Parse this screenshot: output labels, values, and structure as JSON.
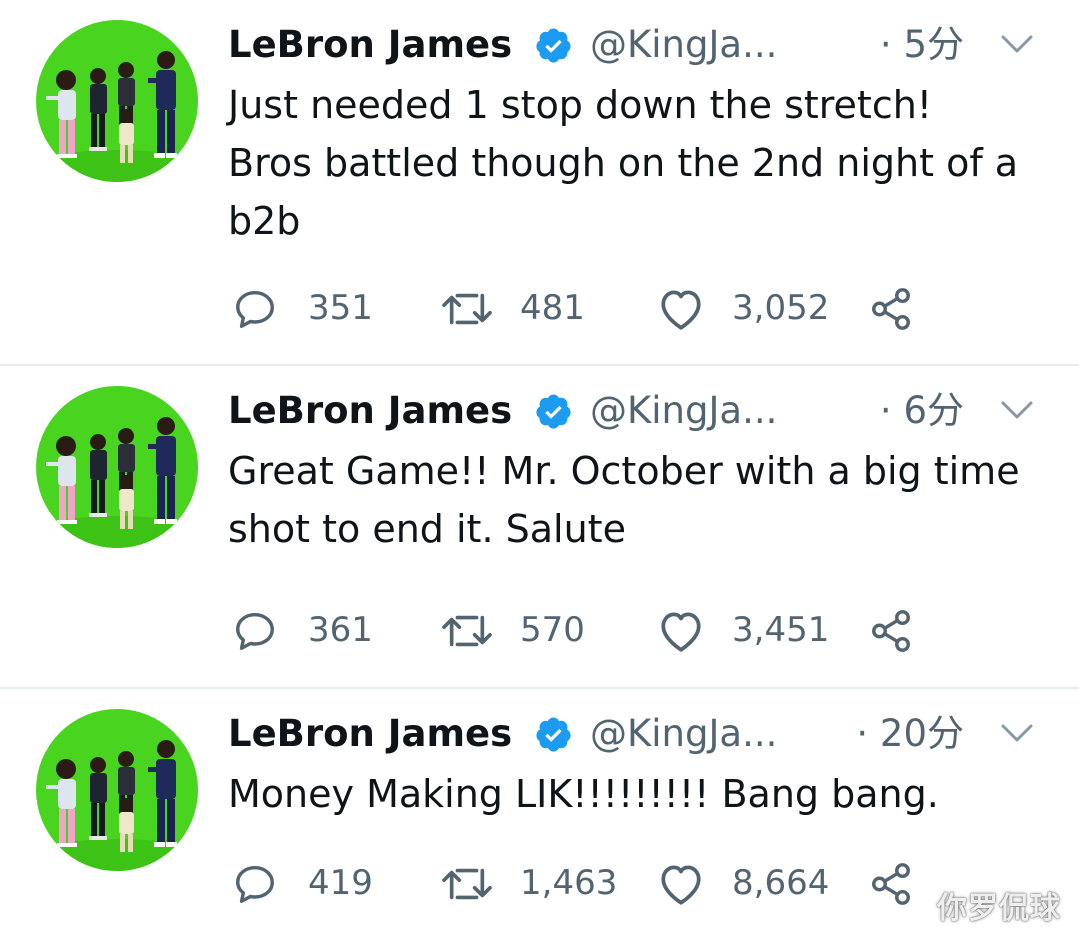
{
  "brand": {
    "verified_color": "#1d9bf0",
    "avatar_bg": "#49d41f",
    "text_secondary": "#536471"
  },
  "icons": {
    "verified": "verified-badge-icon",
    "more": "chevron-down-icon",
    "reply": "reply-bubble-icon",
    "retweet": "retweet-icon",
    "like": "heart-icon",
    "share": "share-icon"
  },
  "tweets": [
    {
      "name": "LeBron James",
      "handle": "@KingJa...",
      "time": "· 5分",
      "text": "Just needed 1 stop down the stretch! Bros battled though on the 2nd night of a b2b",
      "replies": "351",
      "retweets": "481",
      "likes": "3,052"
    },
    {
      "name": "LeBron James",
      "handle": "@KingJa...",
      "time": "· 6分",
      "text": "Great Game!! Mr. October with a big time shot to end it. Salute",
      "replies": "361",
      "retweets": "570",
      "likes": "3,451"
    },
    {
      "name": "LeBron James",
      "handle": "@KingJa...",
      "time": "· 20分",
      "text": "Money Making LIK!!!!!!!!! Bang bang.",
      "replies": "419",
      "retweets": "1,463",
      "likes": "8,664"
    }
  ],
  "watermark": "你罗侃球"
}
